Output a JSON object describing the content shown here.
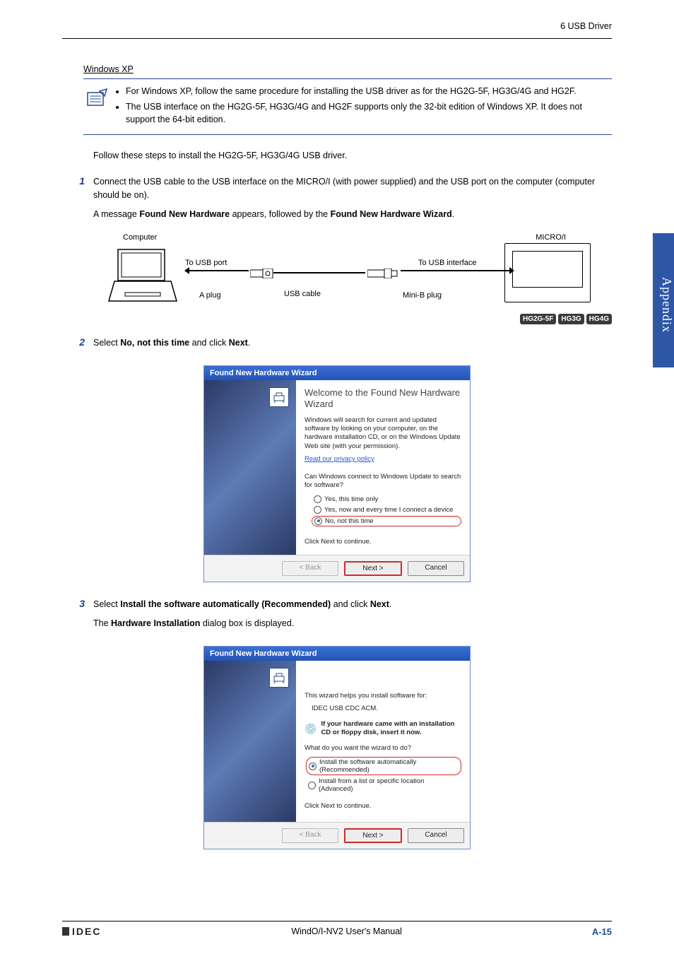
{
  "header": {
    "breadcrumb": "6 USB Driver"
  },
  "sidetab": "Appendix",
  "section_title": "Windows XP",
  "note": {
    "items": [
      "For Windows XP, follow the same procedure for installing the USB driver as for the HG2G-5F, HG3G/4G and HG2F.",
      "The USB interface on the HG2G-5F, HG3G/4G and HG2F supports only the 32-bit edition of Windows XP. It does not support the 64-bit edition."
    ]
  },
  "intro": "Follow these steps to install the HG2G-5F, HG3G/4G USB driver.",
  "steps": {
    "s1": {
      "num": "1",
      "text": "Connect the USB cable to the USB interface on the MICRO/I (with power supplied) and the USB port on the computer (computer should be on).",
      "msg_prefix": "A message ",
      "msg_b1": "Found New Hardware",
      "msg_mid": " appears, followed by the ",
      "msg_b2": "Found New Hardware Wizard",
      "msg_suffix": "."
    },
    "s2": {
      "num": "2",
      "pre": "Select ",
      "b1": "No, not this time",
      "mid": " and click ",
      "b2": "Next",
      "suf": "."
    },
    "s3": {
      "num": "3",
      "pre": "Select ",
      "b1": "Install the software automatically (Recommended)",
      "mid": " and click ",
      "b2": "Next",
      "suf": ".",
      "line2a": "The ",
      "line2b": "Hardware Installation",
      "line2c": " dialog box is displayed."
    }
  },
  "diagram": {
    "computer": "Computer",
    "to_usb_port": "To USB port",
    "a_plug": "A plug",
    "usb_cable": "USB cable",
    "minib_plug": "Mini-B plug",
    "to_usb_iface": "To USB interface",
    "microi": "MICRO/I",
    "tags": [
      "HG2G-5F",
      "HG3G",
      "HG4G"
    ]
  },
  "wizard1": {
    "title": "Found New Hardware Wizard",
    "heading": "Welcome to the Found New Hardware Wizard",
    "desc": "Windows will search for current and updated software by looking on your computer, on the hardware installation CD, or on the Windows Update Web site (with your permission).",
    "privacy": "Read our privacy policy",
    "question": "Can Windows connect to Windows Update to search for software?",
    "opt1": "Yes, this time only",
    "opt2": "Yes, now and every time I connect a device",
    "opt3": "No, not this time",
    "continue": "Click Next to continue.",
    "back": "< Back",
    "next": "Next >",
    "cancel": "Cancel"
  },
  "wizard2": {
    "title": "Found New Hardware Wizard",
    "helps": "This wizard helps you install software for:",
    "device": "IDEC USB CDC ACM.",
    "cdtext": "If your hardware came with an installation CD or floppy disk, insert it now.",
    "question": "What do you want the wizard to do?",
    "opt1": "Install the software automatically (Recommended)",
    "opt2": "Install from a list or specific location (Advanced)",
    "continue": "Click Next to continue.",
    "back": "< Back",
    "next": "Next >",
    "cancel": "Cancel"
  },
  "footer": {
    "logo": "IDEC",
    "center": "WindO/I-NV2 User's Manual",
    "right": "A-15"
  }
}
